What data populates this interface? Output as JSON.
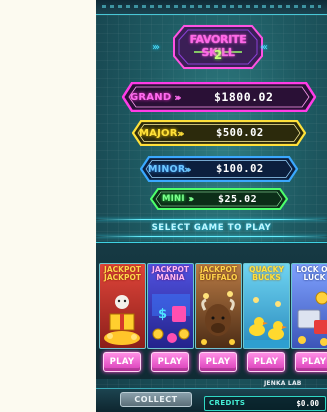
{
  "game": {
    "title_line1": "FAVORITE SKILL",
    "title_line2": "2"
  },
  "jackpots": [
    {
      "name": "GRAND",
      "value": "$1800.02",
      "color": "#ff3ce6"
    },
    {
      "name": "MAJOR",
      "value": "$500.02",
      "color": "#ffe13a"
    },
    {
      "name": "MINOR",
      "value": "$100.02",
      "color": "#3aa8ff"
    },
    {
      "name": "MINI",
      "value": "$25.02",
      "color": "#4dff6b"
    }
  ],
  "select_label": "SELECT GAME TO PLAY",
  "games": [
    {
      "title": "JACKPOT JACKPOT",
      "line1": "JACKPOT",
      "line2": "JACKPOT",
      "play_label": "PLAY",
      "bg": "#c2372c",
      "title_color": "#ffd64a"
    },
    {
      "title": "JACKPOT MANIA",
      "line1": "JACKPOT",
      "line2": "MANIA",
      "play_label": "PLAY",
      "bg": "#3b3fc4",
      "title_color": "#ff9ee6"
    },
    {
      "title": "JACKPOT BUFFALO",
      "line1": "JACKPOT",
      "line2": "BUFFALO",
      "play_label": "PLAY",
      "bg": "#8d5a36",
      "title_color": "#ffd24a"
    },
    {
      "title": "QUACKY BUCKS",
      "line1": "QUACKY",
      "line2": "BUCKS",
      "play_label": "PLAY",
      "bg": "#3fb2d8",
      "title_color": "#ffe23c"
    },
    {
      "title": "LOCK OF LUCK",
      "line1": "LOCK OF",
      "line2": "LUCK",
      "play_label": "PLAY",
      "bg": "#5a7de0",
      "title_color": "#ffffff"
    }
  ],
  "brand": "JENKA LAB",
  "bottom": {
    "collect_label": "COLLECT",
    "credits_label": "CREDITS",
    "credits_value": "$0.00"
  },
  "colors": {
    "accent_pink": "#ff3ce6",
    "accent_cyan": "#5fe0ef",
    "background": "#1e5a62"
  },
  "icons": [
    "chevron-right-icon",
    "chevron-left-icon",
    "coin-icon",
    "duck-icon",
    "buffalo-icon",
    "gift-icon"
  ]
}
